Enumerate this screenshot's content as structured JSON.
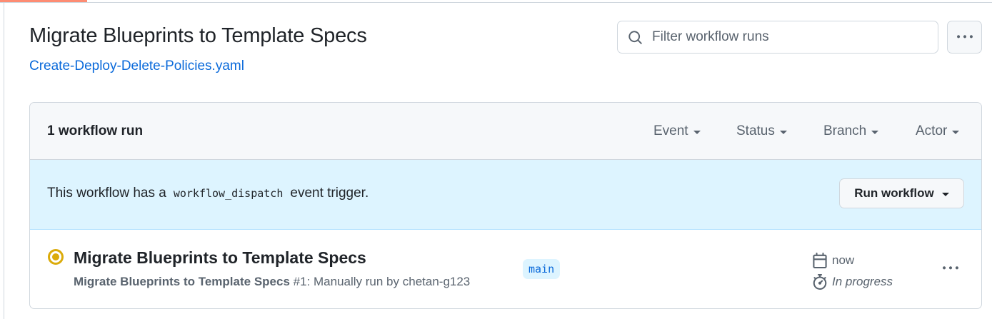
{
  "page": {
    "title": "Migrate Blueprints to Template Specs",
    "workflow_file": "Create-Deploy-Delete-Policies.yaml"
  },
  "search": {
    "placeholder": "Filter workflow runs",
    "value": "",
    "icon": "search-icon"
  },
  "header": {
    "run_count": "1 workflow run",
    "filters": [
      "Event",
      "Status",
      "Branch",
      "Actor"
    ]
  },
  "dispatch": {
    "prefix": "This workflow has a",
    "code": "workflow_dispatch",
    "suffix": "event trigger.",
    "button_label": "Run workflow"
  },
  "runs": [
    {
      "title": "Migrate Blueprints to Template Specs",
      "workflow_name": "Migrate Blueprints to Template Specs",
      "detail": "#1: Manually run by chetan-g123",
      "branch": "main",
      "when": "now",
      "duration": "In progress",
      "status": "in-progress"
    }
  ],
  "colors": {
    "accent": "#fd8c73",
    "link": "#0969da",
    "in_progress": "#dbab0a",
    "banner": "#ddf4ff"
  }
}
